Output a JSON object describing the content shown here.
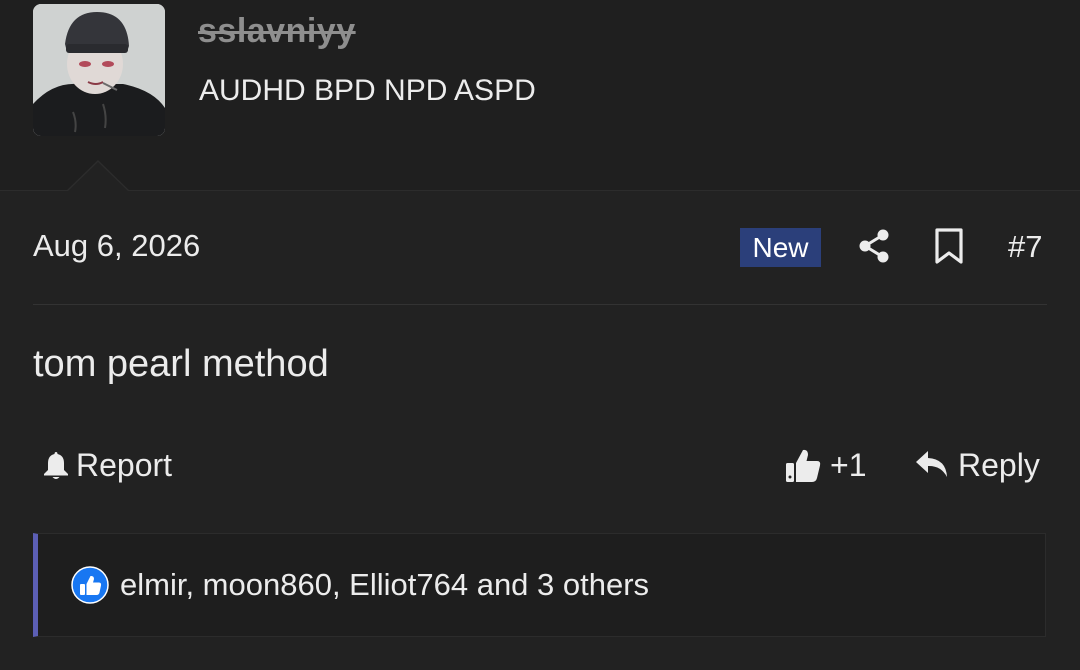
{
  "user": {
    "username": "sslavniyy",
    "user_title": "AUDHD BPD NPD ASPD"
  },
  "post": {
    "date": "Aug 6, 2026",
    "new_badge": "New",
    "post_number": "#7",
    "body": "tom pearl method"
  },
  "actions": {
    "report_label": "Report",
    "like_label": "+1",
    "reply_label": "Reply"
  },
  "reactions": {
    "summary": "elmir, moon860, Elliot764 and 3 others"
  },
  "colors": {
    "background": "#222222",
    "header_background": "#1f1f1f",
    "new_badge": "#2b3f7a",
    "reactions_accent": "#5c5fb5",
    "like_reaction": "#1877f2"
  },
  "icons": [
    "share-icon",
    "bookmark-icon",
    "bell-icon",
    "thumbs-up-icon",
    "reply-icon",
    "like-reaction-icon"
  ]
}
